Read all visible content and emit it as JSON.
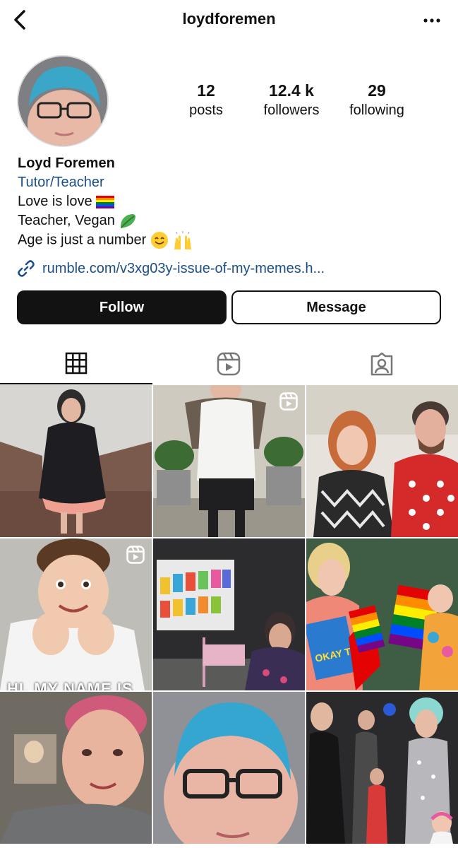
{
  "header": {
    "username": "loydforemen"
  },
  "stats": [
    {
      "number": "12",
      "label": "posts"
    },
    {
      "number": "12.4 k",
      "label": "followers"
    },
    {
      "number": "29",
      "label": "following"
    }
  ],
  "bio": {
    "name": "Loyd Foremen",
    "category": "Tutor/Teacher",
    "line1": "Love is love",
    "line2": "Teacher, Vegan",
    "line3": "Age is just a number"
  },
  "link": {
    "text": "rumble.com/v3xg03y-issue-of-my-memes.h..."
  },
  "buttons": {
    "follow": "Follow",
    "message": "Message"
  },
  "tabs": [
    {
      "name": "grid",
      "icon": "grid-icon",
      "active": true
    },
    {
      "name": "reels",
      "icon": "reels-icon",
      "active": false
    },
    {
      "name": "tagged",
      "icon": "tagged-person-icon",
      "active": false
    }
  ],
  "posts": [
    {
      "desc": "person in polka dot dress in hallway",
      "reel": false
    },
    {
      "desc": "person in white top beside plants",
      "reel": true
    },
    {
      "desc": "two people posing at event",
      "reel": false
    },
    {
      "desc": "child smiling with hands on cheeks",
      "reel": true,
      "caption": "HI, MY NAME IS"
    },
    {
      "desc": "presentation screen with book covers",
      "reel": false
    },
    {
      "desc": "drag performer with rainbow flags and children",
      "reel": false
    },
    {
      "desc": "person with pink hair smiling",
      "reel": false
    },
    {
      "desc": "close-up of person with blue hair and glasses",
      "reel": false
    },
    {
      "desc": "crowd with performer greeting children",
      "reel": false
    }
  ]
}
